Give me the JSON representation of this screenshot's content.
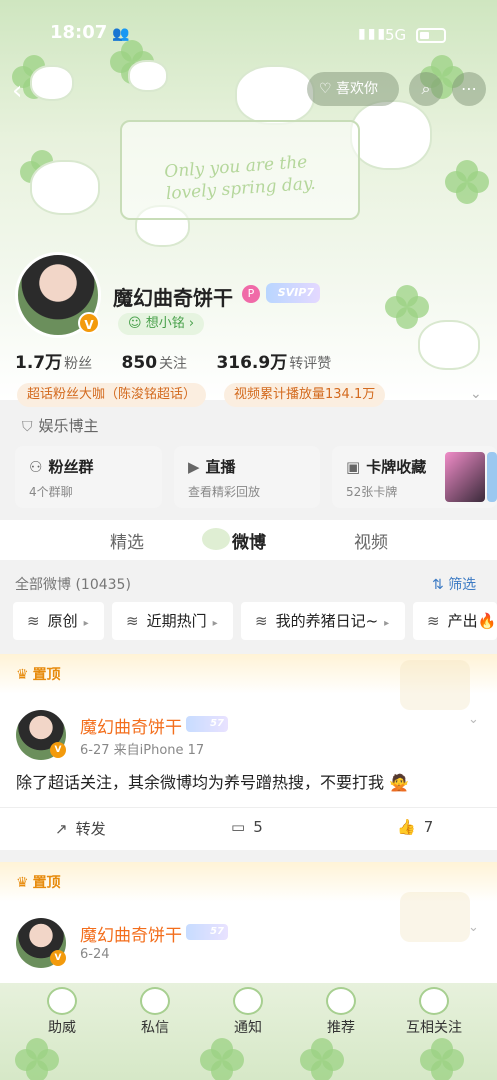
{
  "status_bar": {
    "time": "18:07",
    "network": "5G"
  },
  "header": {
    "like_label": "喜欢你",
    "banner_text": "Only you are the lovely spring day."
  },
  "profile": {
    "name": "魔幻曲奇饼干",
    "vip_badge": "SVIP7",
    "sub_name": "想小铭 ›",
    "fans_value": "1.7万",
    "fans_label": "粉丝",
    "follow_value": "850",
    "follow_label": "关注",
    "repost_value": "316.9万",
    "repost_label": "转评赞",
    "chips": [
      "超话粉丝大咖（陈浚铭超话）",
      "视频累计播放量134.1万"
    ],
    "role": "娱乐博主"
  },
  "features": [
    {
      "icon": "fans-group-icon",
      "title": "粉丝群",
      "sub": "4个群聊"
    },
    {
      "icon": "live-icon",
      "title": "直播",
      "sub": "查看精彩回放"
    },
    {
      "icon": "card-icon",
      "title": "卡牌收藏",
      "sub": "52张卡牌"
    }
  ],
  "tabs": [
    "精选",
    "微博",
    "视频"
  ],
  "feed": {
    "all_count": "全部微博 (10435)",
    "filter_label": "筛选",
    "pills": [
      "原创",
      "近期热门",
      "我的养猪日记~",
      "产出🔥"
    ]
  },
  "posts": [
    {
      "pin_label": "置顶",
      "author": "魔幻曲奇饼干",
      "level": "57",
      "meta": "6-27  来自iPhone 17",
      "text": "除了超话关注，其余微博均为养号蹭热搜，不要打我 🙅",
      "repost_label": "转发",
      "comment_count": "5",
      "like_count": "7"
    },
    {
      "pin_label": "置顶",
      "author": "魔幻曲奇饼干",
      "level": "57",
      "meta": "6-24"
    }
  ],
  "bottom_nav": [
    "助威",
    "私信",
    "通知",
    "推荐",
    "互相关注"
  ],
  "colors": {
    "accent_orange": "#f36e1c",
    "link_blue": "#3d7bc4",
    "clover_green": "#9bd183"
  }
}
